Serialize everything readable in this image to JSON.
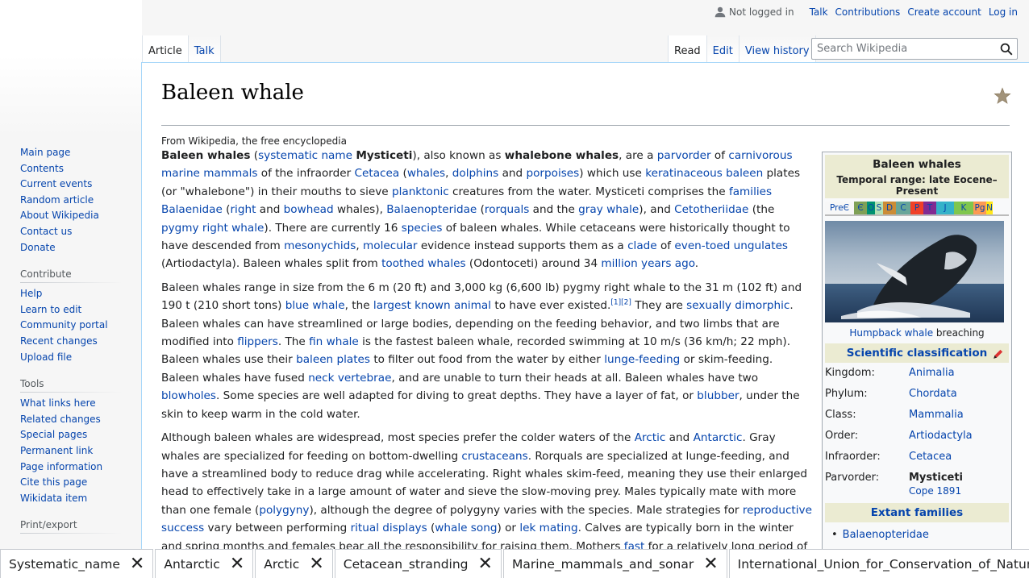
{
  "personal": {
    "not_logged_in": "Not logged in",
    "talk": "Talk",
    "contributions": "Contributions",
    "create_account": "Create account",
    "login": "Log in"
  },
  "tabs": {
    "article": "Article",
    "talk": "Talk",
    "read": "Read",
    "edit": "Edit",
    "view_history": "View history"
  },
  "search": {
    "placeholder": "Search Wikipedia"
  },
  "sidebar": {
    "nav": [
      "Main page",
      "Contents",
      "Current events",
      "Random article",
      "About Wikipedia",
      "Contact us",
      "Donate"
    ],
    "contribute_heading": "Contribute",
    "contribute": [
      "Help",
      "Learn to edit",
      "Community portal",
      "Recent changes",
      "Upload file"
    ],
    "tools_heading": "Tools",
    "tools": [
      "What links here",
      "Related changes",
      "Special pages",
      "Permanent link",
      "Page information",
      "Cite this page",
      "Wikidata item"
    ],
    "print_heading": "Print/export"
  },
  "article": {
    "title": "Baleen whale",
    "site_sub": "From Wikipedia, the free encyclopedia"
  },
  "infobox": {
    "title": "Baleen whales",
    "temporal": "Temporal range: late Eocene–Present",
    "timebar": [
      {
        "label": "PreЄ",
        "color": "#f7f7f7"
      },
      {
        "label": "Є",
        "color": "#7fa056"
      },
      {
        "label": "O",
        "color": "#009270"
      },
      {
        "label": "S",
        "color": "#b3e1b6"
      },
      {
        "label": "D",
        "color": "#cb8c37"
      },
      {
        "label": "C",
        "color": "#67a599"
      },
      {
        "label": "P",
        "color": "#f04028"
      },
      {
        "label": "T",
        "color": "#812b92"
      },
      {
        "label": "J",
        "color": "#34b2c9"
      },
      {
        "label": "K",
        "color": "#7fc64e"
      },
      {
        "label": "Pg",
        "color": "#fd9a52"
      },
      {
        "label": "N",
        "color": "#ffe619"
      }
    ],
    "caption_link": "Humpback whale",
    "caption_rest": " breaching",
    "sci_heading": "Scientific classification",
    "rows": [
      {
        "k": "Kingdom:",
        "v": "Animalia",
        "link": true
      },
      {
        "k": "Phylum:",
        "v": "Chordata",
        "link": true
      },
      {
        "k": "Class:",
        "v": "Mammalia",
        "link": true
      },
      {
        "k": "Order:",
        "v": "Artiodactyla",
        "link": true
      },
      {
        "k": "Infraorder:",
        "v": "Cetacea",
        "link": true
      },
      {
        "k": "Parvorder:",
        "v": "Mysticeti",
        "link": false
      }
    ],
    "authority": "Cope 1891",
    "families_heading": "Extant families",
    "families": [
      "Balaenopteridae"
    ]
  },
  "bottom_tabs": [
    "Systematic_name",
    "Antarctic",
    "Arctic",
    "Cetacean_stranding",
    "Marine_mammals_and_sonar",
    "International_Union_for_Conservation_of_Nature"
  ]
}
